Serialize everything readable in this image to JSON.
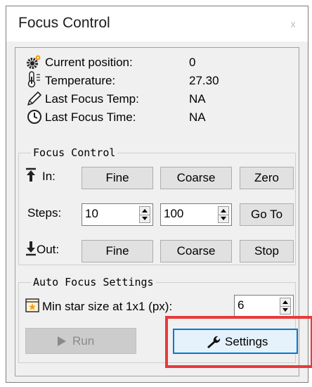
{
  "window": {
    "title": "Focus Control",
    "close_glyph": "x"
  },
  "info": {
    "current_position_label": "Current position:",
    "current_position_value": "0",
    "temperature_label": "Temperature:",
    "temperature_value": "27.30",
    "last_focus_temp_label": "Last Focus Temp:",
    "last_focus_temp_value": "NA",
    "last_focus_time_label": "Last Focus Time:",
    "last_focus_time_value": "NA"
  },
  "focus_control": {
    "group_title": "Focus Control",
    "in_label": "In:",
    "in_fine": "Fine",
    "in_coarse": "Coarse",
    "zero": "Zero",
    "steps_label": "Steps:",
    "steps_fine_value": "10",
    "steps_coarse_value": "100",
    "goto": "Go To",
    "out_label": "Out:",
    "out_fine": "Fine",
    "out_coarse": "Coarse",
    "stop": "Stop"
  },
  "auto_focus": {
    "group_title": "Auto Focus Settings",
    "min_star_label": "Min star size at 1x1 (px):",
    "min_star_value": "6",
    "run": "Run",
    "settings": "Settings"
  },
  "colors": {
    "highlight": "#e83a3a",
    "focus_border": "#0078d7",
    "icon_orange": "#f0a01e"
  },
  "icons": [
    "gear-icon",
    "thermometer-icon",
    "pen-icon",
    "clock-icon",
    "focus-in-arrow-icon",
    "focus-out-arrow-icon",
    "star-icon",
    "play-icon",
    "wrench-icon"
  ]
}
